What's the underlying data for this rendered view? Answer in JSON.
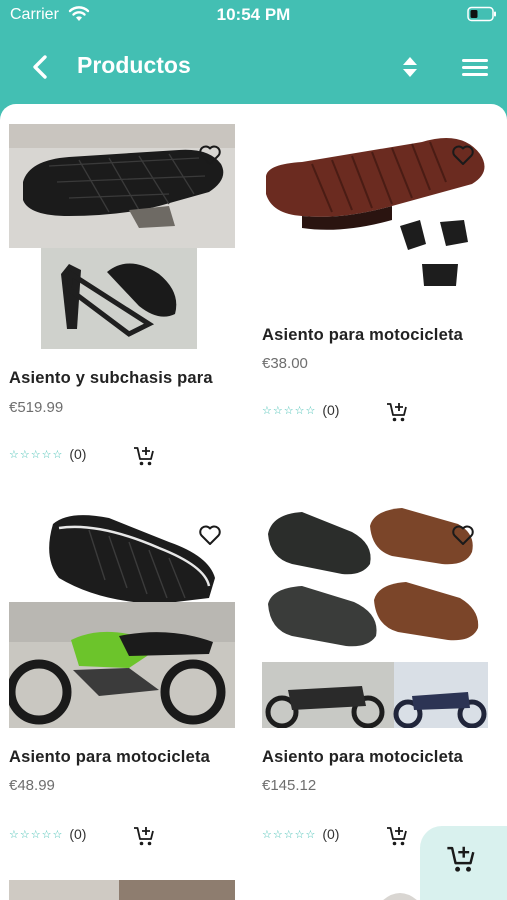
{
  "status_bar": {
    "carrier": "Carrier",
    "time": "10:54 PM"
  },
  "header": {
    "title": "Productos"
  },
  "products": [
    {
      "name": "Asiento y subchasis para",
      "price": "€519.99",
      "stars": "☆☆☆☆☆",
      "reviews": "(0)"
    },
    {
      "name": "Asiento para motocicleta",
      "price": "€38.00",
      "stars": "☆☆☆☆☆",
      "reviews": "(0)"
    },
    {
      "name": "Asiento para motocicleta",
      "price": "€48.99",
      "stars": "☆☆☆☆☆",
      "reviews": "(0)"
    },
    {
      "name": "Asiento para motocicleta",
      "price": "€145.12",
      "stars": "☆☆☆☆☆",
      "reviews": "(0)"
    }
  ],
  "colors": {
    "accent": "#43bfb3",
    "fab_bg": "#d9f1ee"
  },
  "icons": [
    "back-arrow-icon",
    "sort-icon",
    "hamburger-menu-icon",
    "heart-icon",
    "add-to-cart-icon",
    "cart-icon"
  ]
}
